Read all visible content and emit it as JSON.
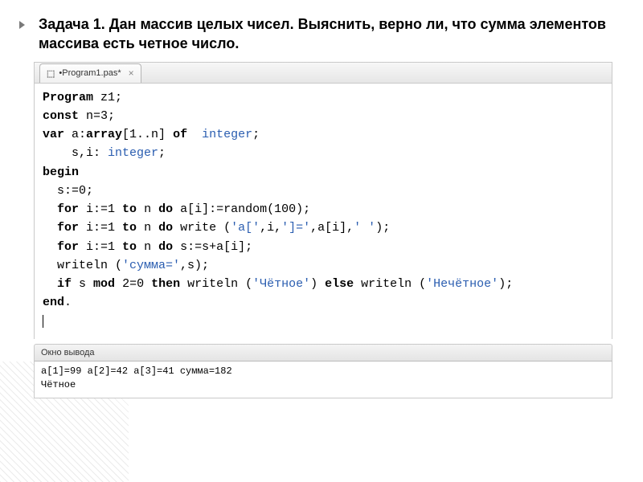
{
  "task": {
    "text": "Задача 1. Дан массив целых чисел. Выяснить, верно ли, что сумма элементов массива есть четное число."
  },
  "tab": {
    "label": "•Program1.pas*"
  },
  "code": {
    "l1_kw": "Program",
    "l1_rest": " z1;",
    "l2_kw": "const",
    "l2_rest": " n=3;",
    "l3_kw": "var",
    "l3_mid": " a:",
    "l3_kw2": "array",
    "l3_mid2": "[1..n] ",
    "l3_kw3": "of",
    "l3_ty": "  integer",
    "l3_end": ";",
    "l4_pad": "    ",
    "l4_mid": "s,i: ",
    "l4_ty": "integer",
    "l4_end": ";",
    "l5_kw": "begin",
    "l6": "  s:=0;",
    "l7_pad": "  ",
    "l7_kw1": "for",
    "l7_a": " i:=1 ",
    "l7_kw2": "to",
    "l7_b": " n ",
    "l7_kw3": "do",
    "l7_c": " a[i]:=random(100);",
    "l8_pad": "  ",
    "l8_kw1": "for",
    "l8_a": " i:=1 ",
    "l8_kw2": "to",
    "l8_b": " n ",
    "l8_kw3": "do",
    "l8_c": " write (",
    "l8_s1": "'a['",
    "l8_c2": ",i,",
    "l8_s2": "']='",
    "l8_c3": ",a[i],",
    "l8_s3": "' '",
    "l8_c4": ");",
    "l9_pad": "  ",
    "l9_kw1": "for",
    "l9_a": " i:=1 ",
    "l9_kw2": "to",
    "l9_b": " n ",
    "l9_kw3": "do",
    "l9_c": " s:=s+a[i];",
    "l10_pad": "  ",
    "l10_a": "writeln (",
    "l10_s": "'сумма='",
    "l10_b": ",s);",
    "l11_pad": "  ",
    "l11_kw1": "if",
    "l11_a": " s ",
    "l11_kw2": "mod",
    "l11_b": " 2=0 ",
    "l11_kw3": "then",
    "l11_c": " writeln (",
    "l11_s1": "'Чётное'",
    "l11_d": ") ",
    "l11_kw4": "else",
    "l11_e": " writeln (",
    "l11_s2": "'Нечётное'",
    "l11_f": ");",
    "l12_kw": "end",
    "l12_rest": "."
  },
  "output": {
    "title": "Окно вывода",
    "line1": "a[1]=99 a[2]=42 a[3]=41 сумма=182",
    "line2": "Чётное"
  }
}
